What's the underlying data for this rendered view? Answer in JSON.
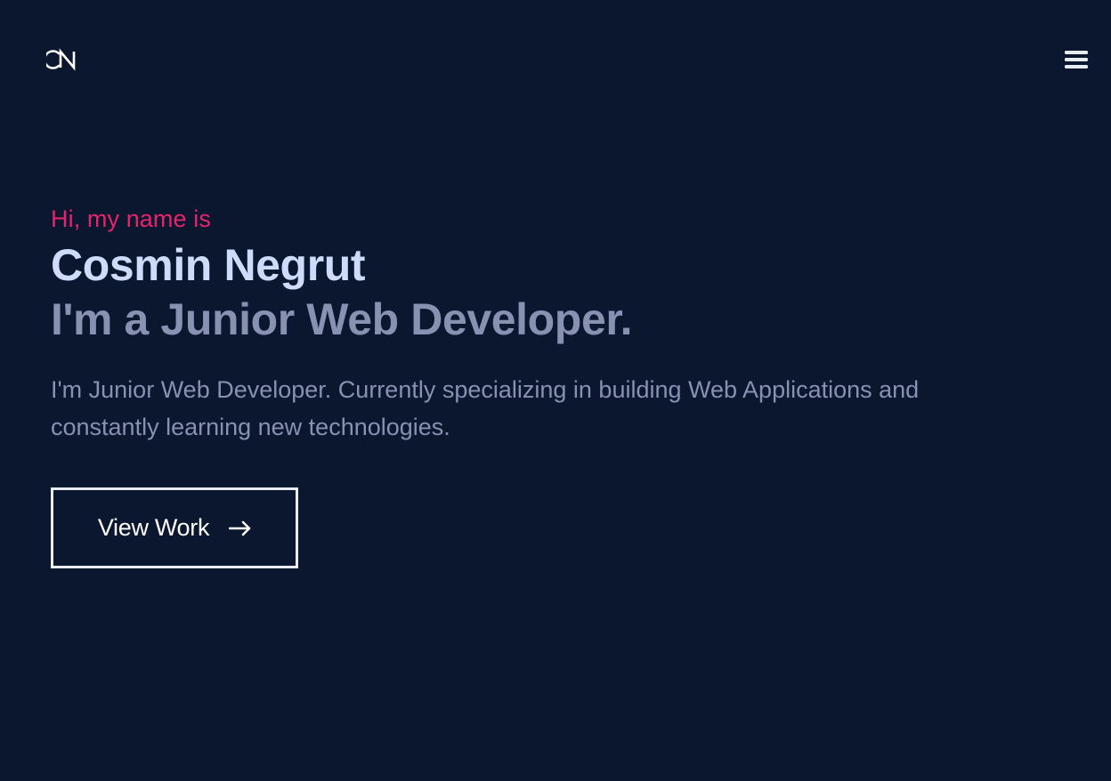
{
  "header": {
    "logo_text": "CN",
    "menu_icon": "hamburger-menu-icon"
  },
  "hero": {
    "greeting": "Hi, my name is",
    "name": "Cosmin Negrut",
    "role": "I'm a Junior Web Developer.",
    "description": "I'm Junior Web Developer. Currently specializing in building Web Applications and constantly learning new technologies.",
    "cta_label": "View Work",
    "cta_icon": "arrow-right-icon"
  },
  "colors": {
    "background": "#0b172e",
    "accent": "#e6246e",
    "name_text": "#cfdbfa",
    "muted_text": "#8891b2",
    "button_border": "#e9ecf3"
  }
}
